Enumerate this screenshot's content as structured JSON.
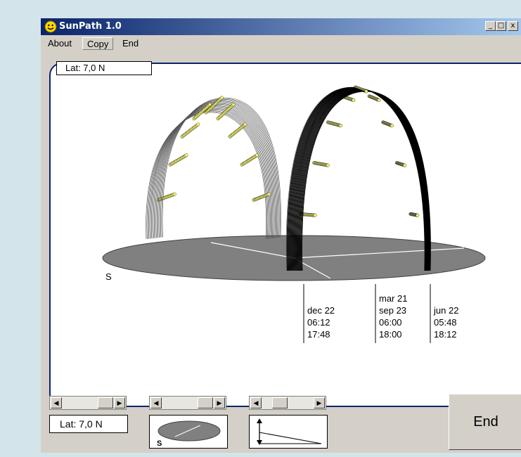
{
  "window": {
    "title": "SunPath 1.0",
    "minimize_glyph": "_",
    "restore_glyph": "□",
    "close_glyph": "x"
  },
  "menu": {
    "items": [
      {
        "label": "About"
      },
      {
        "label": "Copy"
      },
      {
        "label": "End"
      }
    ]
  },
  "plot": {
    "lat_label": "Lat: 7,0 N",
    "south_label": "S",
    "annotations": [
      {
        "lines": [
          "dec 22",
          "06:12",
          "17:48"
        ]
      },
      {
        "lines": [
          "mar 21",
          "sep 23",
          "06:00",
          "18:00"
        ]
      },
      {
        "lines": [
          "jun 22",
          "05:48",
          "18:12"
        ]
      }
    ]
  },
  "controls": {
    "latitude_field": "Lat: 7,0 N",
    "orientation_label": "S",
    "scrollbar_left_arrow": "◀",
    "scrollbar_right_arrow": "▶",
    "end_button": "End"
  },
  "latitude_deg": 7.0,
  "colors": {
    "titlebar_start": "#0a246a",
    "titlebar_end": "#a6caf0",
    "ground": "#808080",
    "sun_marker": "#ffff66",
    "frame": "#0a246a"
  },
  "icons": {
    "app": "smiley-icon",
    "ground": "ground-disk-icon",
    "tilt": "tilt-triangle-icon"
  }
}
